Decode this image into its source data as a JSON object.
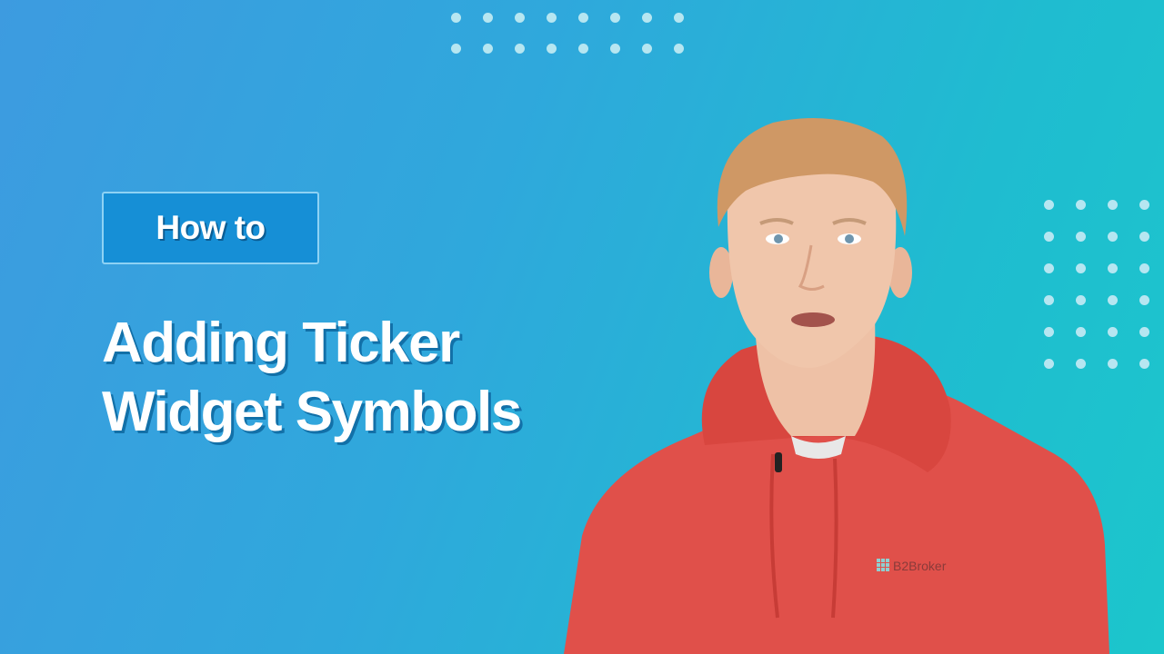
{
  "badge": {
    "label": "How to"
  },
  "title": {
    "line1": "Adding Ticker",
    "line2": "Widget Symbols"
  },
  "presenter": {
    "shirt_logo": "B2Broker"
  },
  "decor": {
    "top_dots": {
      "rows": 2,
      "cols": 8
    },
    "right_dots": {
      "rows": 6,
      "cols": 4
    }
  },
  "colors": {
    "gradient_start": "#3d9be0",
    "gradient_end": "#1cc6cc",
    "badge_fill": "#168fd6",
    "badge_border": "#8ed2f4",
    "dot": "#b6e6f1",
    "hoodie": "#e0504a"
  }
}
